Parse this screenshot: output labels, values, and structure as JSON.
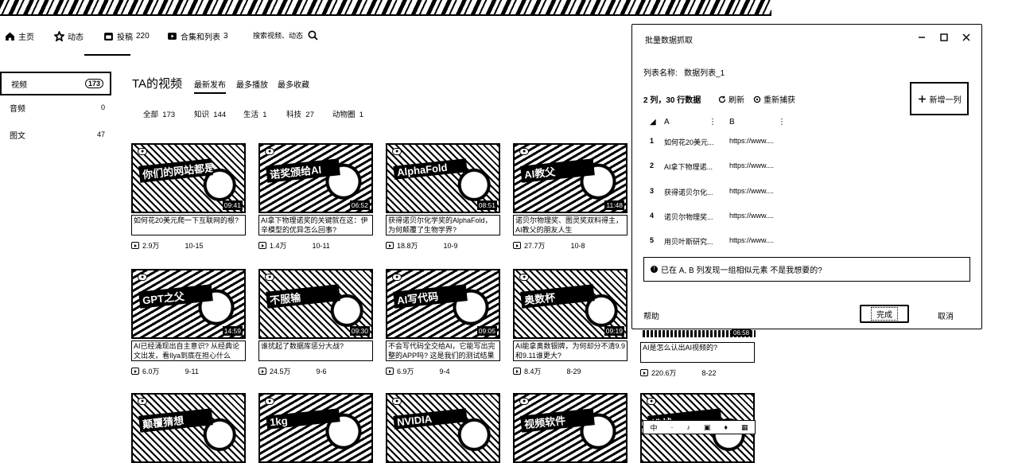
{
  "nav": {
    "home": "主页",
    "dynamic": "动态",
    "posts": "投稿",
    "posts_count": "220",
    "collections": "合集和列表",
    "collections_count": "3",
    "search_placeholder": "搜索视频、动态"
  },
  "sidebar": {
    "items": [
      {
        "label": "视频",
        "count": "173"
      },
      {
        "label": "音频",
        "count": "0"
      },
      {
        "label": "图文",
        "count": "47"
      }
    ]
  },
  "main": {
    "title": "TA的视频",
    "sort_tabs": [
      "最新发布",
      "最多播放",
      "最多收藏"
    ],
    "filters": [
      {
        "label": "全部",
        "count": "173"
      },
      {
        "label": "知识",
        "count": "144"
      },
      {
        "label": "生活",
        "count": "1"
      },
      {
        "label": "科技",
        "count": "27"
      },
      {
        "label": "动物圈",
        "count": "1"
      }
    ]
  },
  "videos": [
    {
      "thumb_text": "你们的网站都是我的",
      "duration": "09:41",
      "title": "如何花20美元爬一下互联网的根?",
      "views": "2.9万",
      "date": "10-15"
    },
    {
      "thumb_text": "诺奖颁给AI",
      "duration": "06:52",
      "title": "AI拿下物理诺奖的关键就在这：伊辛模型的优异怎么回事?",
      "views": "1.4万",
      "date": "10-11"
    },
    {
      "thumb_text": "AlphaFold",
      "duration": "08:51",
      "title": "获得诺贝尔化学奖的AlphaFold，为何颠覆了生物学界?",
      "views": "18.8万",
      "date": "10-9"
    },
    {
      "thumb_text": "AI教父",
      "duration": "11:48",
      "title": "诺贝尔物理奖、图灵奖双料得主，AI教父的朋友人生",
      "views": "27.7万",
      "date": "10-8"
    },
    {
      "thumb_text": "GPT之父",
      "duration": "14:59",
      "title": "AI已经涌现出自主意识? 从经典论文出发，看Ilya到底在担心什么",
      "views": "6.0万",
      "date": "9-11"
    },
    {
      "thumb_text": "不服输",
      "duration": "09:30",
      "title": "谁扰起了数据库惩分大战?",
      "views": "24.5万",
      "date": "9-6"
    },
    {
      "thumb_text": "AI写代码",
      "duration": "09:05",
      "title": "不会写代码全交给AI，它能写出完整的APP吗? 这是我们的测试结果",
      "views": "6.9万",
      "date": "9-4"
    },
    {
      "thumb_text": "奥数杯",
      "duration": "09:19",
      "title": "AI能拿奥数银牌，为何却分不清9.9和9.11谁更大?",
      "views": "8.4万",
      "date": "8-29"
    },
    {
      "thumb_text": "",
      "duration": "06:58",
      "title": "AI是怎么认出AI视频的?",
      "views": "220.6万",
      "date": "8-22"
    }
  ],
  "next_row_thumbs": [
    "颠覆猜想",
    "1kg",
    "NVIDIA",
    "视频软件",
    "挑战"
  ],
  "dialog": {
    "title": "批量数据抓取",
    "list_name_label": "列表名称:",
    "list_name_value": "数据列表_1",
    "stats": "2 列，30 行数据",
    "refresh": "刷新",
    "recapture": "重新捕获",
    "add_column": "新增一列",
    "columns": [
      "A",
      "B"
    ],
    "rows": [
      {
        "num": "1",
        "a": "如何花20美元...",
        "b": "https://www...."
      },
      {
        "num": "2",
        "a": "AI拿下物理诺...",
        "b": "https://www...."
      },
      {
        "num": "3",
        "a": "获得诺贝尔化...",
        "b": "https://www...."
      },
      {
        "num": "4",
        "a": "诺贝尔物理奖...",
        "b": "https://www...."
      },
      {
        "num": "5",
        "a": "用贝叶斯研究...",
        "b": "https://www...."
      }
    ],
    "notice": "已在 A, B 列发现一组相似元素  不是我想要的?",
    "help": "帮助",
    "ok": "完成",
    "cancel": "取消"
  },
  "player_controls": [
    "中",
    "·",
    "♪",
    "▣",
    "♦",
    "▦"
  ]
}
